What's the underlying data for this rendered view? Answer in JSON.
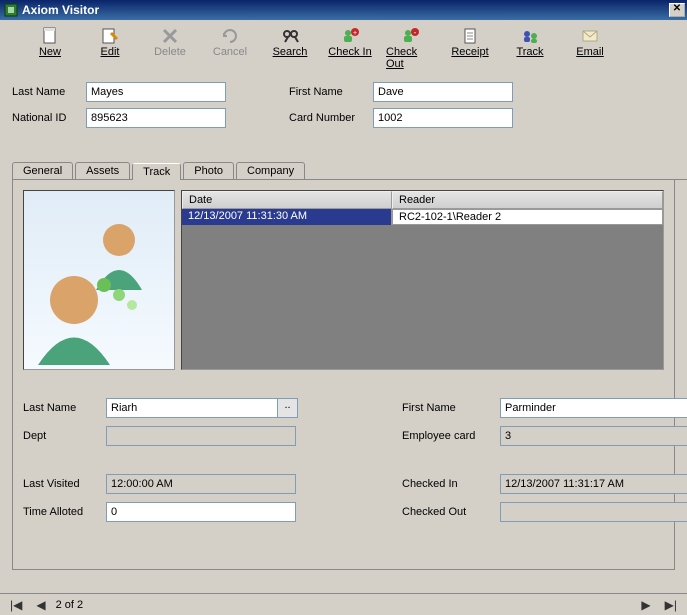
{
  "window": {
    "title": "Axiom  Visitor"
  },
  "toolbar": {
    "new": "New",
    "edit": "Edit",
    "delete": "Delete",
    "cancel": "Cancel",
    "search": "Search",
    "checkin": "Check In",
    "checkout": "Check Out",
    "receipt": "Receipt",
    "track": "Track",
    "email": "Email"
  },
  "top": {
    "last_name_label": "Last Name",
    "last_name": "Mayes",
    "first_name_label": "First Name",
    "first_name": "Dave",
    "national_id_label": "National ID",
    "national_id": "895623",
    "card_number_label": "Card Number",
    "card_number": "1002"
  },
  "tabs": {
    "general": "General",
    "assets": "Assets",
    "track": "Track",
    "photo": "Photo",
    "company": "Company"
  },
  "grid": {
    "head_date": "Date",
    "head_reader": "Reader",
    "row_date": "12/13/2007 11:31:30 AM",
    "row_reader": "RC2-102-1\\Reader 2"
  },
  "lower": {
    "last_name_label": "Last Name",
    "last_name": "Riarh",
    "picker_btn": "..",
    "first_name_label": "First Name",
    "first_name": "Parminder",
    "dept_label": "Dept",
    "dept": "",
    "emp_card_label": "Employee card",
    "emp_card": "3",
    "last_visited_label": "Last Visited",
    "last_visited": "12:00:00 AM",
    "checked_in_label": "Checked In",
    "checked_in": "12/13/2007 11:31:17 AM",
    "time_allotted_label": "Time Alloted",
    "time_allotted": "0",
    "checked_out_label": "Checked Out",
    "checked_out": ""
  },
  "nav": {
    "pos": "2 of 2",
    "first": "|◀",
    "prev": "◀",
    "next": "▶",
    "last": "▶|"
  }
}
